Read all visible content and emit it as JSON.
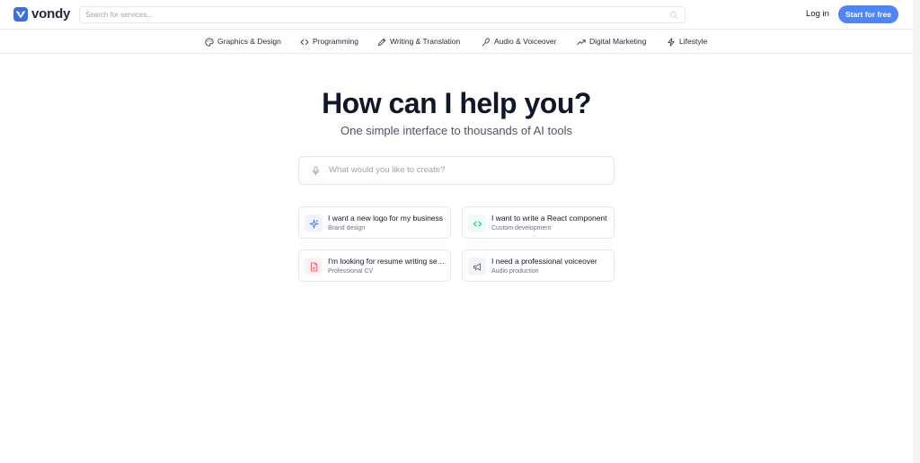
{
  "brand": {
    "name": "vondy",
    "color": "#3b6fe0"
  },
  "search": {
    "placeholder": "Search for services..."
  },
  "header": {
    "login_label": "Log in",
    "start_label": "Start for free",
    "accent": "#4f86f7"
  },
  "categories": [
    {
      "label": "Graphics & Design",
      "icon": "palette-icon"
    },
    {
      "label": "Programming",
      "icon": "code-icon"
    },
    {
      "label": "Writing & Translation",
      "icon": "pen-icon"
    },
    {
      "label": "Audio & Voiceover",
      "icon": "microphone-icon"
    },
    {
      "label": "Digital Marketing",
      "icon": "trending-up-icon"
    },
    {
      "label": "Lifestyle",
      "icon": "lightning-icon"
    }
  ],
  "hero": {
    "title": "How can I help you?",
    "subtitle": "One simple interface to thousands of AI tools",
    "prompt_placeholder": "What would you like to create?"
  },
  "suggestions": [
    {
      "title": "I want a new logo for my business",
      "subtitle": "Brand design",
      "icon": "sparkles-icon"
    },
    {
      "title": "I want to write a React component",
      "subtitle": "Custom development",
      "icon": "code-icon"
    },
    {
      "title": "I'm looking for resume writing services",
      "subtitle": "Professional CV",
      "icon": "document-icon"
    },
    {
      "title": "I need a professional voiceover",
      "subtitle": "Audio production",
      "icon": "megaphone-icon"
    }
  ]
}
